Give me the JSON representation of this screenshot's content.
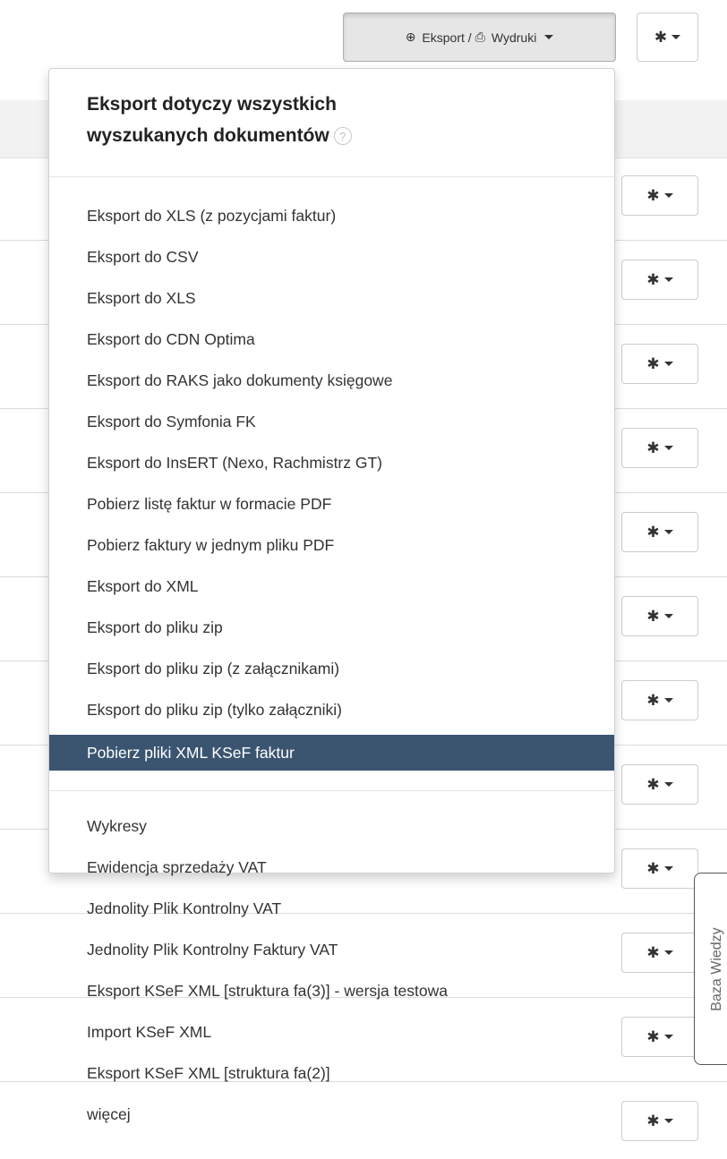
{
  "toolbar": {
    "export_label": "Eksport /",
    "prints_label": "Wydruki"
  },
  "dropdown": {
    "header_line1": "Eksport dotyczy wszystkich",
    "header_line2": "wyszukanych dokumentów",
    "help": "?",
    "export_items": [
      "Eksport do XLS (z pozycjami faktur)",
      "Eksport do CSV",
      "Eksport do XLS",
      "Eksport do CDN Optima",
      "Eksport do RAKS jako dokumenty księgowe",
      "Eksport do Symfonia FK",
      "Eksport do InsERT (Nexo, Rachmistrz GT)",
      "Pobierz listę faktur w formacie PDF",
      "Pobierz faktury w jednym pliku PDF",
      "Eksport do XML",
      "Eksport do pliku zip",
      "Eksport do pliku zip (z załącznikami)",
      "Eksport do pliku zip (tylko załączniki)",
      "Pobierz pliki XML KSeF faktur"
    ],
    "other_items": [
      "Wykresy",
      "Ewidencja sprzedaży VAT",
      "Jednolity Plik Kontrolny VAT",
      "Jednolity Plik Kontrolny Faktury VAT",
      "Eksport KSeF XML [struktura fa(3)] - wersja testowa",
      "Import KSeF XML",
      "Eksport KSeF XML [struktura fa(2)]",
      "więcej"
    ]
  },
  "side_tab": {
    "label": "Baza Wiedzy"
  },
  "colors": {
    "active": "#3b5571"
  }
}
